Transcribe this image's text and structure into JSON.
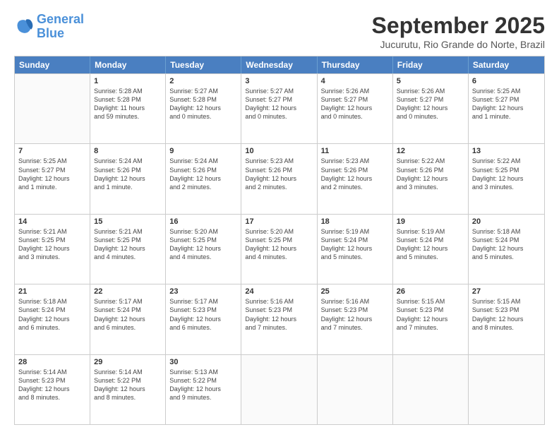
{
  "logo": {
    "line1": "General",
    "line2": "Blue"
  },
  "title": "September 2025",
  "subtitle": "Jucurutu, Rio Grande do Norte, Brazil",
  "days": [
    "Sunday",
    "Monday",
    "Tuesday",
    "Wednesday",
    "Thursday",
    "Friday",
    "Saturday"
  ],
  "rows": [
    [
      {
        "day": "",
        "text": ""
      },
      {
        "day": "1",
        "text": "Sunrise: 5:28 AM\nSunset: 5:28 PM\nDaylight: 11 hours\nand 59 minutes."
      },
      {
        "day": "2",
        "text": "Sunrise: 5:27 AM\nSunset: 5:28 PM\nDaylight: 12 hours\nand 0 minutes."
      },
      {
        "day": "3",
        "text": "Sunrise: 5:27 AM\nSunset: 5:27 PM\nDaylight: 12 hours\nand 0 minutes."
      },
      {
        "day": "4",
        "text": "Sunrise: 5:26 AM\nSunset: 5:27 PM\nDaylight: 12 hours\nand 0 minutes."
      },
      {
        "day": "5",
        "text": "Sunrise: 5:26 AM\nSunset: 5:27 PM\nDaylight: 12 hours\nand 0 minutes."
      },
      {
        "day": "6",
        "text": "Sunrise: 5:25 AM\nSunset: 5:27 PM\nDaylight: 12 hours\nand 1 minute."
      }
    ],
    [
      {
        "day": "7",
        "text": "Sunrise: 5:25 AM\nSunset: 5:27 PM\nDaylight: 12 hours\nand 1 minute."
      },
      {
        "day": "8",
        "text": "Sunrise: 5:24 AM\nSunset: 5:26 PM\nDaylight: 12 hours\nand 1 minute."
      },
      {
        "day": "9",
        "text": "Sunrise: 5:24 AM\nSunset: 5:26 PM\nDaylight: 12 hours\nand 2 minutes."
      },
      {
        "day": "10",
        "text": "Sunrise: 5:23 AM\nSunset: 5:26 PM\nDaylight: 12 hours\nand 2 minutes."
      },
      {
        "day": "11",
        "text": "Sunrise: 5:23 AM\nSunset: 5:26 PM\nDaylight: 12 hours\nand 2 minutes."
      },
      {
        "day": "12",
        "text": "Sunrise: 5:22 AM\nSunset: 5:26 PM\nDaylight: 12 hours\nand 3 minutes."
      },
      {
        "day": "13",
        "text": "Sunrise: 5:22 AM\nSunset: 5:25 PM\nDaylight: 12 hours\nand 3 minutes."
      }
    ],
    [
      {
        "day": "14",
        "text": "Sunrise: 5:21 AM\nSunset: 5:25 PM\nDaylight: 12 hours\nand 3 minutes."
      },
      {
        "day": "15",
        "text": "Sunrise: 5:21 AM\nSunset: 5:25 PM\nDaylight: 12 hours\nand 4 minutes."
      },
      {
        "day": "16",
        "text": "Sunrise: 5:20 AM\nSunset: 5:25 PM\nDaylight: 12 hours\nand 4 minutes."
      },
      {
        "day": "17",
        "text": "Sunrise: 5:20 AM\nSunset: 5:25 PM\nDaylight: 12 hours\nand 4 minutes."
      },
      {
        "day": "18",
        "text": "Sunrise: 5:19 AM\nSunset: 5:24 PM\nDaylight: 12 hours\nand 5 minutes."
      },
      {
        "day": "19",
        "text": "Sunrise: 5:19 AM\nSunset: 5:24 PM\nDaylight: 12 hours\nand 5 minutes."
      },
      {
        "day": "20",
        "text": "Sunrise: 5:18 AM\nSunset: 5:24 PM\nDaylight: 12 hours\nand 5 minutes."
      }
    ],
    [
      {
        "day": "21",
        "text": "Sunrise: 5:18 AM\nSunset: 5:24 PM\nDaylight: 12 hours\nand 6 minutes."
      },
      {
        "day": "22",
        "text": "Sunrise: 5:17 AM\nSunset: 5:24 PM\nDaylight: 12 hours\nand 6 minutes."
      },
      {
        "day": "23",
        "text": "Sunrise: 5:17 AM\nSunset: 5:23 PM\nDaylight: 12 hours\nand 6 minutes."
      },
      {
        "day": "24",
        "text": "Sunrise: 5:16 AM\nSunset: 5:23 PM\nDaylight: 12 hours\nand 7 minutes."
      },
      {
        "day": "25",
        "text": "Sunrise: 5:16 AM\nSunset: 5:23 PM\nDaylight: 12 hours\nand 7 minutes."
      },
      {
        "day": "26",
        "text": "Sunrise: 5:15 AM\nSunset: 5:23 PM\nDaylight: 12 hours\nand 7 minutes."
      },
      {
        "day": "27",
        "text": "Sunrise: 5:15 AM\nSunset: 5:23 PM\nDaylight: 12 hours\nand 8 minutes."
      }
    ],
    [
      {
        "day": "28",
        "text": "Sunrise: 5:14 AM\nSunset: 5:23 PM\nDaylight: 12 hours\nand 8 minutes."
      },
      {
        "day": "29",
        "text": "Sunrise: 5:14 AM\nSunset: 5:22 PM\nDaylight: 12 hours\nand 8 minutes."
      },
      {
        "day": "30",
        "text": "Sunrise: 5:13 AM\nSunset: 5:22 PM\nDaylight: 12 hours\nand 9 minutes."
      },
      {
        "day": "",
        "text": ""
      },
      {
        "day": "",
        "text": ""
      },
      {
        "day": "",
        "text": ""
      },
      {
        "day": "",
        "text": ""
      }
    ]
  ]
}
